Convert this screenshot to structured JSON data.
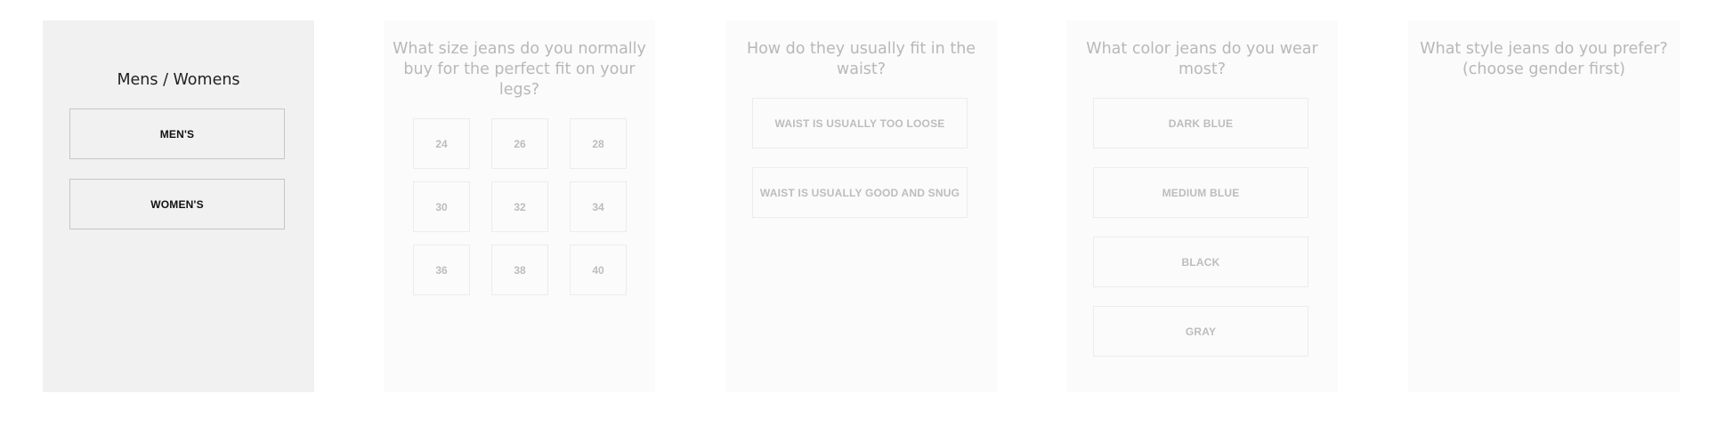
{
  "steps": [
    {
      "title": "Mens / Womens",
      "options": [
        "MEN'S",
        "WOMEN'S"
      ]
    },
    {
      "title": "What size jeans do you normally buy for the perfect fit on your legs?",
      "sizes": [
        "24",
        "26",
        "28",
        "30",
        "32",
        "34",
        "36",
        "38",
        "40"
      ]
    },
    {
      "title": "How do they usually fit in the waist?",
      "options": [
        "WAIST IS USUALLY TOO LOOSE",
        "WAIST IS USUALLY GOOD AND SNUG"
      ]
    },
    {
      "title": "What color jeans do you wear most?",
      "options": [
        "DARK BLUE",
        "MEDIUM BLUE",
        "BLACK",
        "GRAY"
      ]
    },
    {
      "title": "What style jeans do you prefer? (choose gender first)"
    }
  ],
  "colors": {
    "active_panel_bg": "#f1f1f1",
    "inactive_panel_bg": "#fbfbfb",
    "inactive_text": "#b8b8b8"
  }
}
